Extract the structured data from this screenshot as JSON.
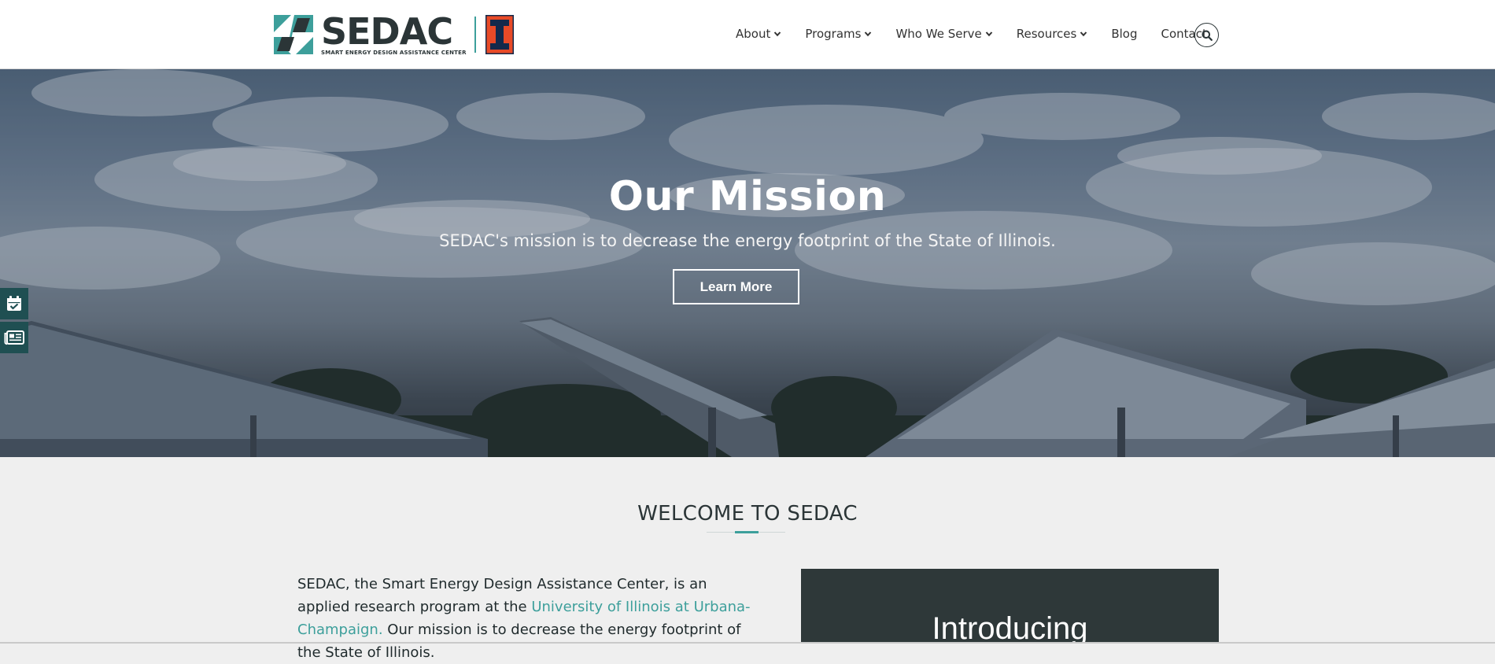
{
  "header": {
    "logo_word": "SEDAC",
    "logo_tagline": "SMART ENERGY DESIGN ASSISTANCE CENTER",
    "nav": [
      {
        "label": "About",
        "has_menu": true
      },
      {
        "label": "Programs",
        "has_menu": true
      },
      {
        "label": "Who We Serve",
        "has_menu": true
      },
      {
        "label": "Resources",
        "has_menu": true
      },
      {
        "label": "Blog",
        "has_menu": false
      },
      {
        "label": "Contact",
        "has_menu": false
      }
    ],
    "search_icon": "search-icon"
  },
  "hero": {
    "title": "Our Mission",
    "subtitle": "SEDAC's mission is to decrease the energy footprint of the State of Illinois.",
    "button_label": "Learn More"
  },
  "side_tabs": [
    {
      "icon": "calendar-check-icon"
    },
    {
      "icon": "newspaper-icon"
    }
  ],
  "welcome": {
    "title": "WELCOME TO SEDAC",
    "text_1": "SEDAC, the Smart Energy Design Assistance Center, is an applied research program at the ",
    "link": "University of Illinois at Urbana-Champaign.",
    "text_2": " Our mission is to decrease the energy footprint of the State of Illinois.",
    "video_title": "Introducing"
  },
  "colors": {
    "brand_dark": "#2b3537",
    "brand_teal": "#3d9f9b",
    "illinois_orange": "#e84a27",
    "side_tab": "#1f4f52"
  }
}
